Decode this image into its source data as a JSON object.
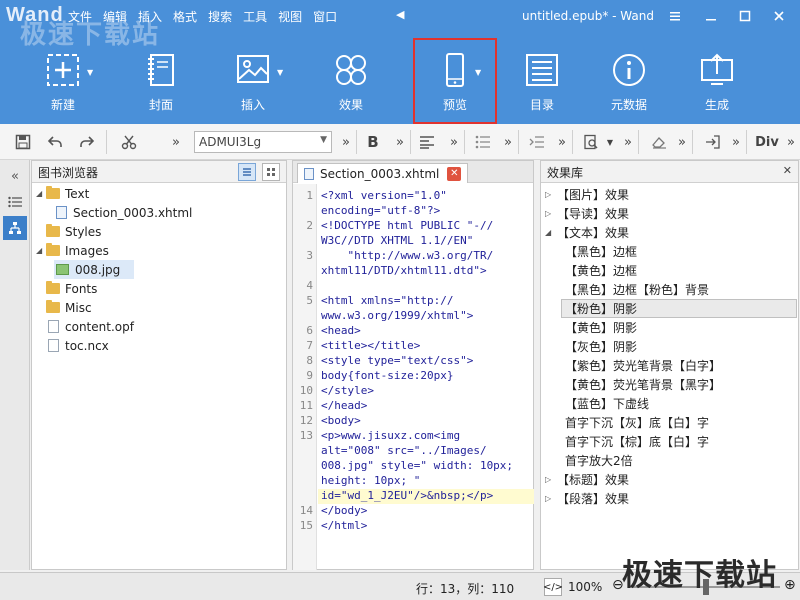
{
  "app": {
    "logo": "Wand",
    "window_title": "untitled.epub* - Wand",
    "watermark": "极速下载站"
  },
  "menu": [
    "文件",
    "编辑",
    "插入",
    "格式",
    "搜索",
    "工具",
    "视图",
    "窗口"
  ],
  "ribbon": [
    {
      "label": "新建",
      "icon": "new-icon"
    },
    {
      "label": "封面",
      "icon": "cover-icon"
    },
    {
      "label": "插入",
      "icon": "insert-image-icon"
    },
    {
      "label": "效果",
      "icon": "effects-icon"
    },
    {
      "label": "预览",
      "icon": "phone-preview-icon"
    },
    {
      "label": "目录",
      "icon": "toc-icon"
    },
    {
      "label": "元数据",
      "icon": "metadata-icon"
    },
    {
      "label": "生成",
      "icon": "generate-icon"
    }
  ],
  "toolbar": {
    "font_value": "ADMUI3Lg",
    "bold": "B",
    "div": "Div"
  },
  "book_browser": {
    "title": "图书浏览器",
    "items": [
      {
        "name": "Text",
        "type": "folder",
        "expanded": true,
        "level": 0
      },
      {
        "name": "Section_0003.xhtml",
        "type": "html",
        "level": 1
      },
      {
        "name": "Styles",
        "type": "folder",
        "level": 0
      },
      {
        "name": "Images",
        "type": "folder",
        "expanded": true,
        "level": 0
      },
      {
        "name": "008.jpg",
        "type": "image",
        "level": 1,
        "selected": true
      },
      {
        "name": "Fonts",
        "type": "folder",
        "level": 0
      },
      {
        "name": "Misc",
        "type": "folder",
        "level": 0
      },
      {
        "name": "content.opf",
        "type": "file",
        "level": 0
      },
      {
        "name": "toc.ncx",
        "type": "file",
        "level": 0
      }
    ]
  },
  "editor": {
    "tab": "Section_0003.xhtml",
    "line_numbers": [
      "1",
      "2",
      "3",
      "4",
      "5",
      "6",
      "7",
      "8",
      "9",
      "10",
      "11",
      "12",
      "13",
      "14",
      "15"
    ],
    "lines": [
      "<?xml version=\"1.0\"",
      "encoding=\"utf-8\"?>",
      "<!DOCTYPE html PUBLIC \"-//",
      "W3C//DTD XHTML 1.1//EN\"",
      "    \"http://www.w3.org/TR/",
      "xhtml11/DTD/xhtml11.dtd\">",
      "",
      "<html xmlns=\"http://",
      "www.w3.org/1999/xhtml\">",
      "<head>",
      "<title></title>",
      "<style type=\"text/css\">",
      "body{font-size:20px}",
      "</style>",
      "</head>",
      "<body>",
      "<p>www.jisuxz.com<img",
      "alt=\"008\" src=\"../Images/",
      "008.jpg\" style=\" width: 10px;",
      "height: 10px; \"",
      "id=\"wd_1_J2EU\"/>&nbsp;</p>",
      "</body>",
      "</html>"
    ]
  },
  "effects": {
    "title": "效果库",
    "items": [
      {
        "label": "【图片】效果",
        "collapsed": true
      },
      {
        "label": "【导读】效果",
        "collapsed": true
      },
      {
        "label": "【文本】效果",
        "expanded": true
      },
      {
        "label": "【黑色】边框"
      },
      {
        "label": "【黄色】边框"
      },
      {
        "label": "【黑色】边框【粉色】背景"
      },
      {
        "label": "【粉色】阴影",
        "selected": true
      },
      {
        "label": "【黄色】阴影"
      },
      {
        "label": "【灰色】阴影"
      },
      {
        "label": "【紫色】荧光笔背景【白字】"
      },
      {
        "label": "【黄色】荧光笔背景【黑字】"
      },
      {
        "label": "【蓝色】下虚线"
      },
      {
        "label": "首字下沉【灰】底【白】字"
      },
      {
        "label": "首字下沉【棕】底【白】字"
      },
      {
        "label": "首字放大2倍"
      },
      {
        "label": "【标题】效果",
        "collapsed": true
      },
      {
        "label": "【段落】效果",
        "collapsed": true
      }
    ]
  },
  "status": {
    "position": "行：13，列：110",
    "zoom": "100%"
  }
}
